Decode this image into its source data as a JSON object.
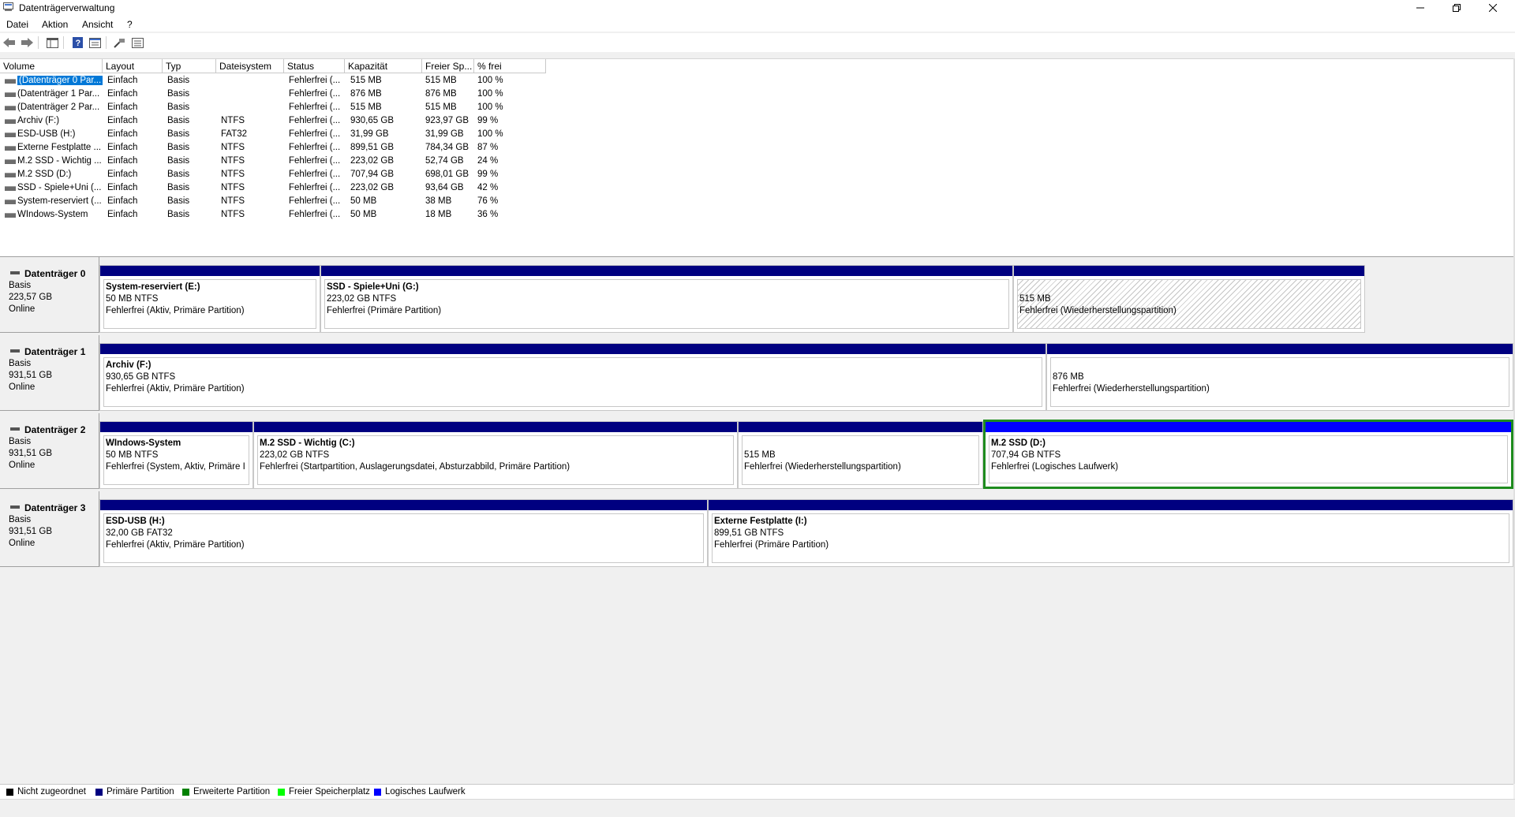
{
  "window": {
    "title": "Datenträgerverwaltung"
  },
  "menu": [
    "Datei",
    "Aktion",
    "Ansicht",
    "?"
  ],
  "volume_table": {
    "columns": [
      "Volume",
      "Layout",
      "Typ",
      "Dateisystem",
      "Status",
      "Kapazität",
      "Freier Sp...",
      "% frei"
    ],
    "rows": [
      [
        "(Datenträger 0 Par...",
        "Einfach",
        "Basis",
        "",
        "Fehlerfrei (...",
        "515 MB",
        "515 MB",
        "100 %"
      ],
      [
        "(Datenträger 1 Par...",
        "Einfach",
        "Basis",
        "",
        "Fehlerfrei (...",
        "876 MB",
        "876 MB",
        "100 %"
      ],
      [
        "(Datenträger 2 Par...",
        "Einfach",
        "Basis",
        "",
        "Fehlerfrei (...",
        "515 MB",
        "515 MB",
        "100 %"
      ],
      [
        "Archiv (F:)",
        "Einfach",
        "Basis",
        "NTFS",
        "Fehlerfrei (...",
        "930,65 GB",
        "923,97 GB",
        "99 %"
      ],
      [
        "ESD-USB (H:)",
        "Einfach",
        "Basis",
        "FAT32",
        "Fehlerfrei (...",
        "31,99 GB",
        "31,99 GB",
        "100 %"
      ],
      [
        "Externe Festplatte ...",
        "Einfach",
        "Basis",
        "NTFS",
        "Fehlerfrei (...",
        "899,51 GB",
        "784,34 GB",
        "87 %"
      ],
      [
        "M.2 SSD - Wichtig ...",
        "Einfach",
        "Basis",
        "NTFS",
        "Fehlerfrei (...",
        "223,02 GB",
        "52,74 GB",
        "24 %"
      ],
      [
        "M.2 SSD (D:)",
        "Einfach",
        "Basis",
        "NTFS",
        "Fehlerfrei (...",
        "707,94 GB",
        "698,01 GB",
        "99 %"
      ],
      [
        "SSD - Spiele+Uni (...",
        "Einfach",
        "Basis",
        "NTFS",
        "Fehlerfrei (...",
        "223,02 GB",
        "93,64 GB",
        "42 %"
      ],
      [
        "System-reserviert (...",
        "Einfach",
        "Basis",
        "NTFS",
        "Fehlerfrei (...",
        "50 MB",
        "38 MB",
        "76 %"
      ],
      [
        "WIndows-System",
        "Einfach",
        "Basis",
        "NTFS",
        "Fehlerfrei (...",
        "50 MB",
        "18 MB",
        "36 %"
      ]
    ]
  },
  "disks": [
    {
      "name": "Datenträger 0",
      "type": "Basis",
      "size": "223,57 GB",
      "state": "Online",
      "partitions": [
        {
          "name": "System-reserviert  (E:)",
          "size": "50 MB NTFS",
          "status": "Fehlerfrei (Aktiv, Primäre Partition)"
        },
        {
          "name": "SSD - Spiele+Uni  (G:)",
          "size": "223,02 GB NTFS",
          "status": "Fehlerfrei (Primäre Partition)"
        },
        {
          "name": "",
          "size": "515 MB",
          "status": "Fehlerfrei (Wiederherstellungspartition)"
        }
      ]
    },
    {
      "name": "Datenträger 1",
      "type": "Basis",
      "size": "931,51 GB",
      "state": "Online",
      "partitions": [
        {
          "name": "Archiv  (F:)",
          "size": "930,65 GB NTFS",
          "status": "Fehlerfrei (Aktiv, Primäre Partition)"
        },
        {
          "name": "",
          "size": "876 MB",
          "status": "Fehlerfrei (Wiederherstellungspartition)"
        }
      ]
    },
    {
      "name": "Datenträger 2",
      "type": "Basis",
      "size": "931,51 GB",
      "state": "Online",
      "partitions": [
        {
          "name": "WIndows-System",
          "size": "50 MB NTFS",
          "status": "Fehlerfrei (System, Aktiv, Primäre I"
        },
        {
          "name": "M.2 SSD - Wichtig  (C:)",
          "size": "223,02 GB NTFS",
          "status": "Fehlerfrei (Startpartition, Auslagerungsdatei, Absturzabbild, Primäre Partition)"
        },
        {
          "name": "",
          "size": "515 MB",
          "status": "Fehlerfrei (Wiederherstellungspartition)"
        },
        {
          "name": "M.2 SSD  (D:)",
          "size": "707,94 GB NTFS",
          "status": "Fehlerfrei (Logisches Laufwerk)"
        }
      ]
    },
    {
      "name": "Datenträger 3",
      "type": "Basis",
      "size": "931,51 GB",
      "state": "Online",
      "partitions": [
        {
          "name": "ESD-USB  (H:)",
          "size": "32,00 GB FAT32",
          "status": "Fehlerfrei (Aktiv, Primäre Partition)"
        },
        {
          "name": "Externe Festplatte  (I:)",
          "size": "899,51 GB NTFS",
          "status": "Fehlerfrei (Primäre Partition)"
        }
      ]
    }
  ],
  "legend": [
    {
      "label": "Nicht zugeordnet",
      "color": "#000000"
    },
    {
      "label": "Primäre Partition",
      "color": "#000080"
    },
    {
      "label": "Erweiterte Partition",
      "color": "#008000"
    },
    {
      "label": "Freier Speicherplatz",
      "color": "#00ff00"
    },
    {
      "label": "Logisches Laufwerk",
      "color": "#0000ff"
    }
  ]
}
